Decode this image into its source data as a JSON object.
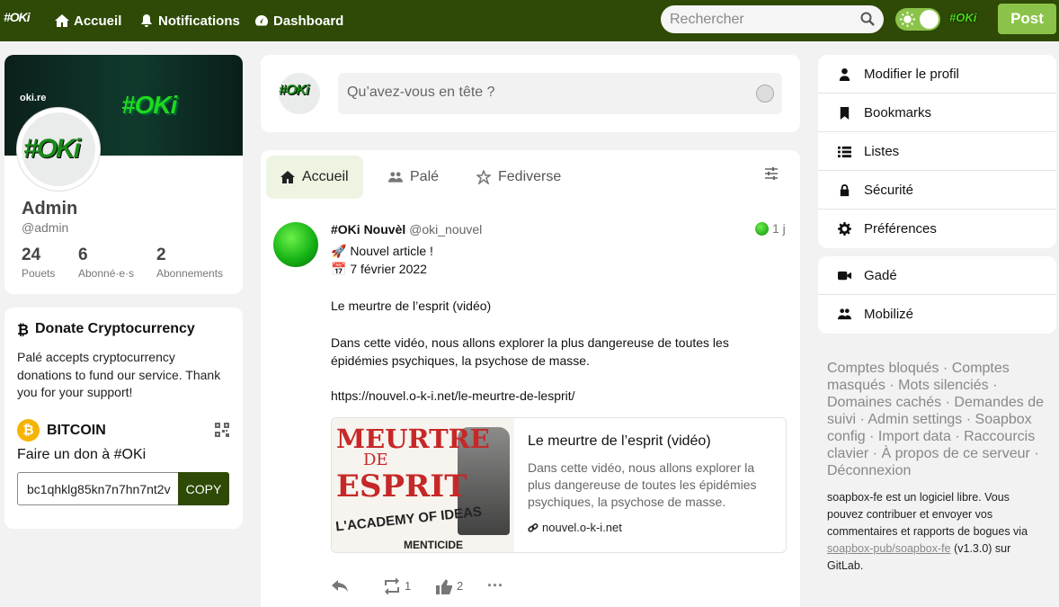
{
  "nav": {
    "logo": "#OKi",
    "links": [
      {
        "label": "Accueil",
        "icon": "home-icon"
      },
      {
        "label": "Notifications",
        "icon": "bell-icon"
      },
      {
        "label": "Dashboard",
        "icon": "dashboard-icon"
      }
    ],
    "search_placeholder": "Rechercher",
    "mini_logo": "#OKi",
    "post_label": "Post"
  },
  "profile": {
    "banner_site": "oki.re",
    "banner_logo": "#OKi",
    "avatar_text": "#OKi",
    "name": "Admin",
    "handle": "@admin",
    "stats": [
      {
        "value": "24",
        "label": "Pouets"
      },
      {
        "value": "6",
        "label": "Abonné·e·s"
      },
      {
        "value": "2",
        "label": "Abonnements"
      }
    ]
  },
  "donate": {
    "title": "Donate Cryptocurrency",
    "description": "Palé accepts cryptocurrency donations to fund our service. Thank you for your support!",
    "coin": "BITCOIN",
    "coin_symbol": "₿",
    "donate_to": "Faire un don à #OKi",
    "address": "bc1qhklg85kn7n7hn7nt2v",
    "copy_label": "COPY"
  },
  "compose": {
    "avatar_text": "#OKi",
    "placeholder": "Qu’avez-vous en tête ?"
  },
  "feed": {
    "tabs": [
      {
        "label": "Accueil",
        "icon": "home-icon",
        "active": true
      },
      {
        "label": "Palé",
        "icon": "users-icon",
        "active": false
      },
      {
        "label": "Fediverse",
        "icon": "fediverse-icon",
        "active": false
      }
    ],
    "post": {
      "author": "#OKi Nouvèl",
      "handle": "@oki_nouvel",
      "time": "1 j",
      "line1": "🚀 Nouvel article !",
      "line2": "📅 7 février 2022",
      "line3": "Le meurtre de l’esprit (vidéo)",
      "line4": "Dans cette vidéo, nous allons explorer la plus dangereuse de toutes les épidémies psychiques, la psychose de masse.",
      "link": "https://nouvel.o-k-i.net/le-meurtre-de-lesprit/",
      "card": {
        "thumb_line1": "MEURTRE",
        "thumb_line2": "DE",
        "thumb_line3": "ESPRIT",
        "thumb_line4": "L'ACADEMY OF IDEAS",
        "thumb_line5": "MENTICIDE",
        "title": "Le meurtre de l’esprit (vidéo)",
        "description": "Dans cette vidéo, nous allons explorer la plus dangereuse de toutes les épidémies psychiques, la psychose de masse.",
        "domain": "nouvel.o-k-i.net"
      },
      "reblogs": "1",
      "likes": "2",
      "more": "···"
    }
  },
  "menu": {
    "group1": [
      {
        "label": "Modifier le profil",
        "icon": "user-icon"
      },
      {
        "label": "Bookmarks",
        "icon": "bookmark-icon"
      },
      {
        "label": "Listes",
        "icon": "list-icon"
      },
      {
        "label": "Sécurité",
        "icon": "lock-icon"
      },
      {
        "label": "Préférences",
        "icon": "gear-icon"
      }
    ],
    "group2": [
      {
        "label": "Gadé",
        "icon": "video-icon"
      },
      {
        "label": "Mobilizé",
        "icon": "group-icon"
      }
    ]
  },
  "footer": {
    "links": [
      "Comptes bloqués",
      "Comptes masqués",
      "Mots silenciés",
      "Domaines cachés",
      "Demandes de suivi",
      "Admin settings",
      "Soapbox config",
      "Import data",
      "Raccourcis clavier",
      "À propos de ce serveur",
      "Déconnexion"
    ],
    "note_prefix": "soapbox-fe est un logiciel libre. Vous pouvez contribuer et envoyer vos commentaires et rapports de bogues via ",
    "note_link": "soapbox-pub/soapbox-fe",
    "note_suffix": " (v1.3.0) sur GitLab."
  },
  "colors": {
    "nav_bg": "#2e4a06",
    "accent": "#8bc34a",
    "page_bg": "#f2f2f2"
  }
}
